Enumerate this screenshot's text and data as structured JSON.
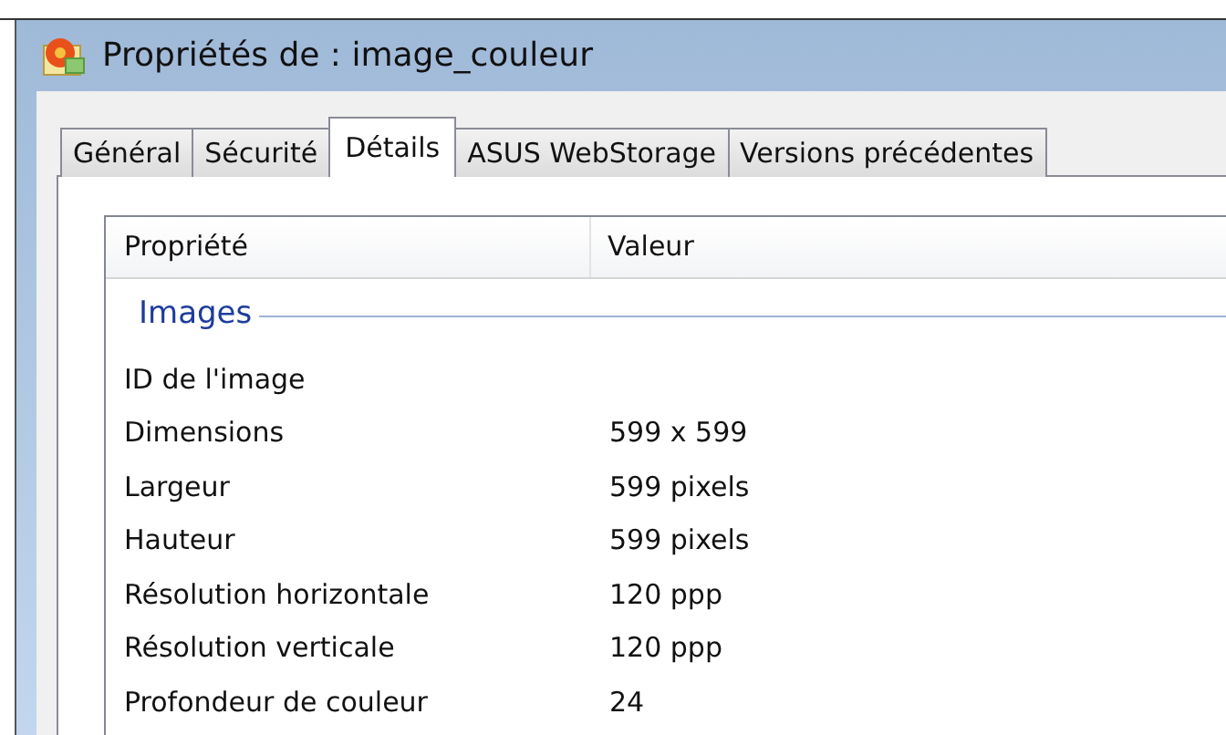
{
  "window": {
    "title": "Propriétés de : image_couleur"
  },
  "tabs": [
    {
      "label": "Général",
      "selected": false
    },
    {
      "label": "Sécurité",
      "selected": false
    },
    {
      "label": "Détails",
      "selected": true
    },
    {
      "label": "ASUS WebStorage",
      "selected": false
    },
    {
      "label": "Versions précédentes",
      "selected": false
    }
  ],
  "table": {
    "columns": [
      "Propriété",
      "Valeur"
    ],
    "group": "Images",
    "rows": [
      {
        "property": "ID de l'image"
      },
      {
        "property": "Dimensions",
        "value": "599 x 599"
      },
      {
        "property": "Largeur",
        "value": "599 pixels"
      },
      {
        "property": "Hauteur",
        "value": "599 pixels"
      },
      {
        "property": "Résolution horizontale",
        "value": "120 ppp"
      },
      {
        "property": "Résolution verticale",
        "value": "120 ppp"
      },
      {
        "property": "Profondeur de couleur",
        "value": "24"
      }
    ]
  }
}
